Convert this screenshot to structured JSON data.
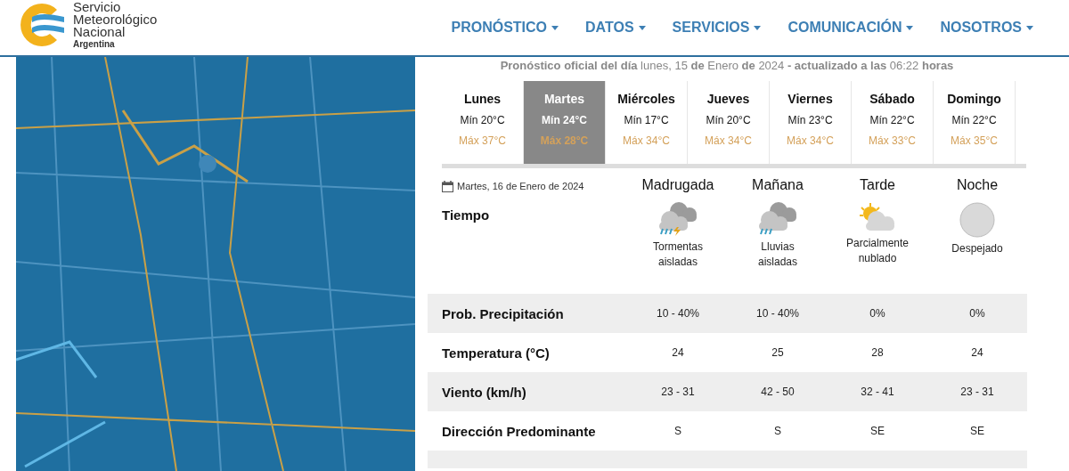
{
  "logo": {
    "lines": [
      "Servicio",
      "Meteorológico",
      "Nacional"
    ],
    "country": "Argentina"
  },
  "nav": [
    {
      "label": "PRONÓSTICO"
    },
    {
      "label": "DATOS"
    },
    {
      "label": "SERVICIOS"
    },
    {
      "label": "COMUNICACIÓN"
    },
    {
      "label": "NOSOTROS"
    }
  ],
  "official": "**Pronóstico oficial del día** lunes, 15 **de** Enero **de** 2024 **- actualizado a las** 06:22 **horas**",
  "days": [
    {
      "name": "Lunes",
      "min": "Mín 20°C",
      "max": "Máx 37°C",
      "selected": false
    },
    {
      "name": "Martes",
      "min": "Mín 24°C",
      "max": "Máx 28°C",
      "selected": true
    },
    {
      "name": "Miércoles",
      "min": "Mín 17°C",
      "max": "Máx 34°C",
      "selected": false
    },
    {
      "name": "Jueves",
      "min": "Mín 20°C",
      "max": "Máx 34°C",
      "selected": false
    },
    {
      "name": "Viernes",
      "min": "Mín 23°C",
      "max": "Máx 34°C",
      "selected": false
    },
    {
      "name": "Sábado",
      "min": "Mín 22°C",
      "max": "Máx 33°C",
      "selected": false
    },
    {
      "name": "Domingo",
      "min": "Mín 22°C",
      "max": "Máx 35°C",
      "selected": false
    }
  ],
  "detail": {
    "date": "Martes, 16 de Enero de 2024",
    "periods": [
      "Madrugada",
      "Mañana",
      "Tarde",
      "Noche"
    ],
    "weather_label": "Tiempo",
    "weather": [
      {
        "kind": "storm",
        "text": "Tormentas aisladas"
      },
      {
        "kind": "rain",
        "text": "Lluvias aisladas"
      },
      {
        "kind": "partly",
        "text": "Parcialmente nublado"
      },
      {
        "kind": "clear",
        "text": "Despejado"
      }
    ],
    "rows": [
      {
        "label": "Prob. Precipitación",
        "values": [
          "10 - 40%",
          "10 - 40%",
          "0%",
          "0%"
        ]
      },
      {
        "label": "Temperatura (°C)",
        "values": [
          "24",
          "25",
          "28",
          "24"
        ]
      },
      {
        "label": "Viento (km/h)",
        "values": [
          "23 - 31",
          "42 - 50",
          "32 - 41",
          "23 - 31"
        ]
      },
      {
        "label": "Dirección Predominante",
        "values": [
          "S",
          "S",
          "SE",
          "SE"
        ]
      }
    ]
  }
}
